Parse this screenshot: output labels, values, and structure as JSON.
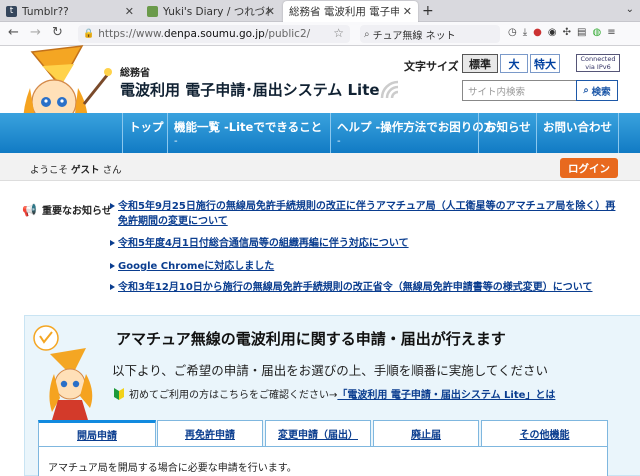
{
  "browser": {
    "tabs": [
      {
        "title": "Tumblr??",
        "favicon": "tumblr-icon"
      },
      {
        "title": "Yuki's Diary / つれづれE",
        "favicon": "diary-icon"
      },
      {
        "title": "総務省 電波利用 電子申請 - L",
        "favicon": "site-icon"
      }
    ],
    "url_prefix": "https://www.",
    "url_host": "denpa.soumu.go.jp",
    "url_path": "/public2/",
    "search_text": "チュア無線 ネット"
  },
  "header": {
    "ministry": "総務省",
    "title": "電波利用 電子申請･届出システム Lite",
    "font_size_label": "文字サイズ",
    "font_sizes": [
      "標準",
      "大",
      "特大"
    ],
    "ipv6_badge_line1": "Connected",
    "ipv6_badge_line2": "via IPv6",
    "search_placeholder": "サイト内検索",
    "search_button": "検索"
  },
  "global_nav": [
    {
      "label": "トップ",
      "sub": ""
    },
    {
      "label": "機能一覧 -Liteでできること",
      "sub": "-"
    },
    {
      "label": "ヘルプ -操作方法でお困りの方",
      "sub": "-"
    },
    {
      "label": "お知らせ",
      "sub": ""
    },
    {
      "label": "お問い合わせ",
      "sub": ""
    }
  ],
  "welcome": {
    "prefix": "ようこそ",
    "user": "ゲスト",
    "suffix": "さん"
  },
  "login_button": "ログイン",
  "news": {
    "heading": "重要なお知らせ",
    "items": [
      "令和5年9月25日施行の無線局免許手続規則の改正に伴うアマチュア局（人工衛星等のアマチュア局を除く）再免許期間の変更について",
      "令和5年度4月1日付総合通信局等の組織再編に伴う対応について",
      "Google Chromeに対応しました",
      "令和3年12月10日から施行の無線局免許手続規則の改正省令（無線局免許申請書等の様式変更）について"
    ]
  },
  "panel": {
    "title": "アマチュア無線の電波利用に関する申請・届出が行えます",
    "subtitle": "以下より、ご希望の申請・届出をお選びの上、手順を順番に実施してください",
    "first_time_text": "初めてご利用の方はこちらをご確認ください→",
    "first_time_link": "「電波利用 電子申請・届出システム Lite」とは",
    "tabs": [
      "開局申請",
      "再免許申請",
      "変更申請（届出）",
      "廃止届",
      "その他機能"
    ],
    "active_tab_text": "アマチュア局を開局する場合に必要な申請を行います。"
  },
  "colors": {
    "nav_blue": "#117bc4",
    "login_orange": "#e8691e",
    "link_blue": "#0a3d8f",
    "panel_bg": "#eaf5fb"
  }
}
